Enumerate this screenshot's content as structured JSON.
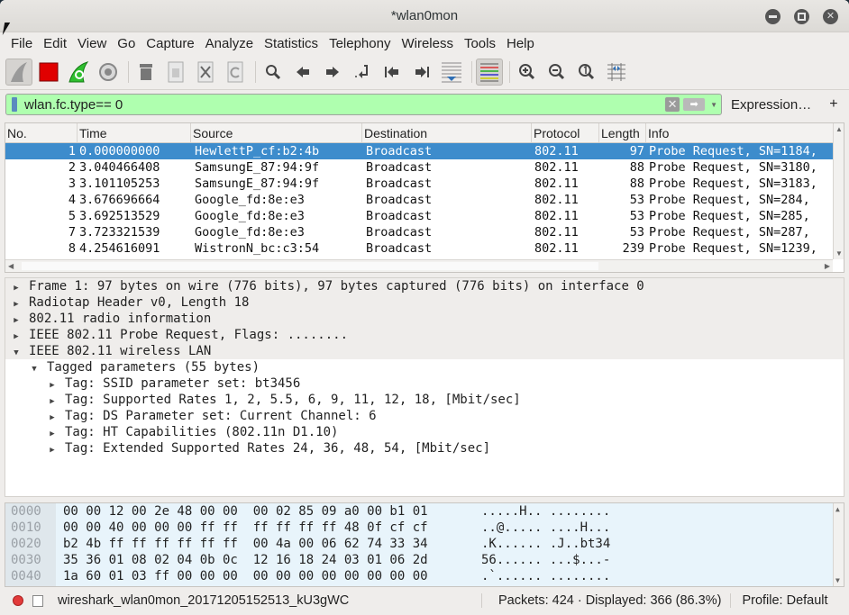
{
  "window": {
    "title": "*wlan0mon",
    "controls": [
      "minimize",
      "maximize",
      "close"
    ]
  },
  "menubar": {
    "items": [
      {
        "label": "File",
        "mnemonic": "F"
      },
      {
        "label": "Edit",
        "mnemonic": "E"
      },
      {
        "label": "View",
        "mnemonic": "V"
      },
      {
        "label": "Go",
        "mnemonic": "G"
      },
      {
        "label": "Capture",
        "mnemonic": "C"
      },
      {
        "label": "Analyze",
        "mnemonic": "A"
      },
      {
        "label": "Statistics",
        "mnemonic": "S"
      },
      {
        "label": "Telephony",
        "mnemonic": "y"
      },
      {
        "label": "Wireless",
        "mnemonic": "W"
      },
      {
        "label": "Tools",
        "mnemonic": "T"
      },
      {
        "label": "Help",
        "mnemonic": "H"
      }
    ]
  },
  "toolbar": {
    "buttons": [
      {
        "icon": "shark-fin-icon",
        "pressed": true
      },
      {
        "icon": "stop-icon",
        "color": "#e00000"
      },
      {
        "icon": "restart-capture-icon",
        "color": "#2fbf2f"
      },
      {
        "icon": "capture-options-icon"
      },
      {
        "icon": "open-file-icon"
      },
      {
        "icon": "save-file-icon"
      },
      {
        "icon": "close-file-icon"
      },
      {
        "icon": "reload-file-icon"
      },
      {
        "icon": "find-packet-icon"
      },
      {
        "icon": "go-back-icon"
      },
      {
        "icon": "go-forward-icon"
      },
      {
        "icon": "go-to-packet-icon"
      },
      {
        "icon": "first-packet-icon"
      },
      {
        "icon": "last-packet-icon"
      },
      {
        "icon": "autoscroll-icon"
      },
      {
        "icon": "colorize-icon",
        "pressed": true
      },
      {
        "icon": "zoom-in-icon"
      },
      {
        "icon": "zoom-out-icon"
      },
      {
        "icon": "normal-size-icon"
      },
      {
        "icon": "resize-columns-icon"
      }
    ]
  },
  "filter": {
    "value": "wlan.fc.type== 0",
    "background": "#afffaf",
    "expression_label": "Expression…",
    "add_label": "+"
  },
  "packet_list": {
    "columns": [
      "No.",
      "Time",
      "Source",
      "Destination",
      "Protocol",
      "Length",
      "Info"
    ],
    "rows": [
      {
        "no": "1",
        "time": "0.000000000",
        "source": "HewlettP_cf:b2:4b",
        "destination": "Broadcast",
        "protocol": "802.11",
        "length": "97",
        "info": "Probe Request, SN=1184,",
        "selected": true
      },
      {
        "no": "2",
        "time": "3.040466408",
        "source": "SamsungE_87:94:9f",
        "destination": "Broadcast",
        "protocol": "802.11",
        "length": "88",
        "info": "Probe Request, SN=3180,"
      },
      {
        "no": "3",
        "time": "3.101105253",
        "source": "SamsungE_87:94:9f",
        "destination": "Broadcast",
        "protocol": "802.11",
        "length": "88",
        "info": "Probe Request, SN=3183,"
      },
      {
        "no": "4",
        "time": "3.676696664",
        "source": "Google_fd:8e:e3",
        "destination": "Broadcast",
        "protocol": "802.11",
        "length": "53",
        "info": "Probe Request, SN=284,"
      },
      {
        "no": "5",
        "time": "3.692513529",
        "source": "Google_fd:8e:e3",
        "destination": "Broadcast",
        "protocol": "802.11",
        "length": "53",
        "info": "Probe Request, SN=285,"
      },
      {
        "no": "7",
        "time": "3.723321539",
        "source": "Google_fd:8e:e3",
        "destination": "Broadcast",
        "protocol": "802.11",
        "length": "53",
        "info": "Probe Request, SN=287,"
      },
      {
        "no": "8",
        "time": "4.254616091",
        "source": "WistronN_bc:c3:54",
        "destination": "Broadcast",
        "protocol": "802.11",
        "length": "239",
        "info": "Probe Request, SN=1239,"
      }
    ],
    "selected_color": "#3d8ccc"
  },
  "details": {
    "items": [
      {
        "text": "Frame 1: 97 bytes on wire (776 bits), 97 bytes captured (776 bits) on interface 0",
        "level": 0,
        "expanded": false
      },
      {
        "text": "Radiotap Header v0, Length 18",
        "level": 0,
        "expanded": false
      },
      {
        "text": "802.11 radio information",
        "level": 0,
        "expanded": false
      },
      {
        "text": "IEEE 802.11 Probe Request, Flags: ........",
        "level": 0,
        "expanded": false
      },
      {
        "text": "IEEE 802.11 wireless LAN",
        "level": 0,
        "expanded": true
      },
      {
        "text": "Tagged parameters (55 bytes)",
        "level": 1,
        "expanded": true
      },
      {
        "text": "Tag: SSID parameter set: bt3456",
        "level": 2,
        "expanded": false
      },
      {
        "text": "Tag: Supported Rates 1, 2, 5.5, 6, 9, 11, 12, 18, [Mbit/sec]",
        "level": 2,
        "expanded": false
      },
      {
        "text": "Tag: DS Parameter set: Current Channel: 6",
        "level": 2,
        "expanded": false
      },
      {
        "text": "Tag: HT Capabilities (802.11n D1.10)",
        "level": 2,
        "expanded": false
      },
      {
        "text": "Tag: Extended Supported Rates 24, 36, 48, 54, [Mbit/sec]",
        "level": 2,
        "expanded": false
      }
    ]
  },
  "bytes": {
    "rows": [
      {
        "offset": "0000",
        "hex": "00 00 12 00 2e 48 00 00  00 02 85 09 a0 00 b1 01",
        "ascii": ".....H.. ........"
      },
      {
        "offset": "0010",
        "hex": "00 00 40 00 00 00 ff ff  ff ff ff ff 48 0f cf cf",
        "ascii": "..@..... ....H..."
      },
      {
        "offset": "0020",
        "hex": "b2 4b ff ff ff ff ff ff  00 4a 00 06 62 74 33 34",
        "ascii": ".K...... .J..bt34"
      },
      {
        "offset": "0030",
        "hex": "35 36 01 08 02 04 0b 0c  12 16 18 24 03 01 06 2d",
        "ascii": "56...... ...$...-"
      },
      {
        "offset": "0040",
        "hex": "1a 60 01 03 ff 00 00 00  00 00 00 00 00 00 00 00",
        "ascii": ".`...... ........"
      }
    ]
  },
  "statusbar": {
    "file": "wireshark_wlan0mon_20171205152513_kU3gWC",
    "packets": "Packets: 424 · Displayed: 366 (86.3%)",
    "profile": "Profile: Default"
  }
}
